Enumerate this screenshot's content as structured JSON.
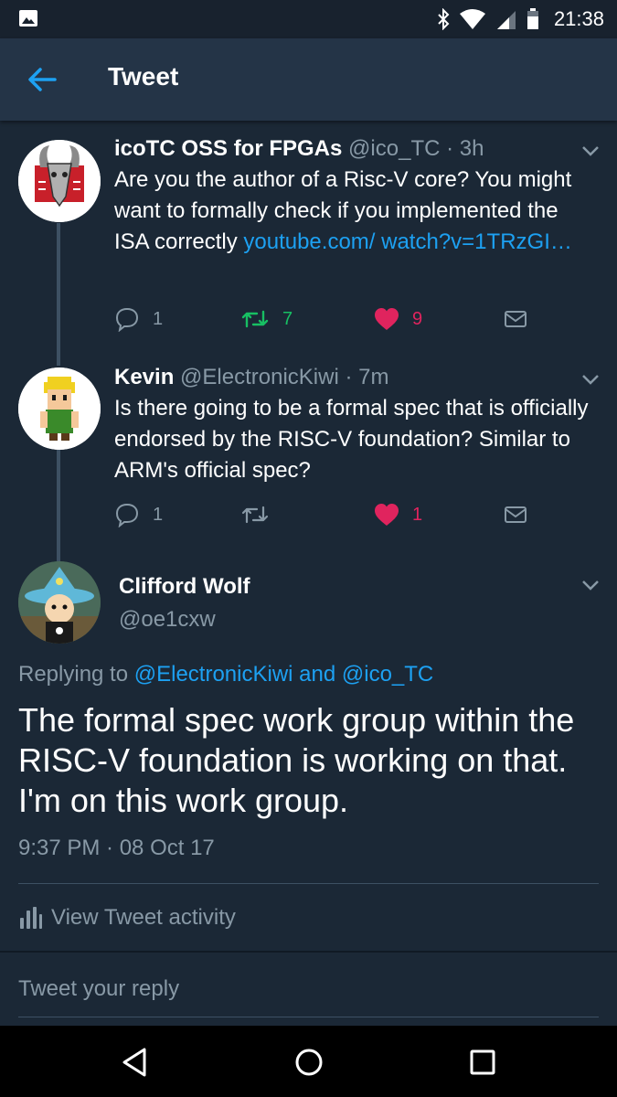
{
  "status_bar": {
    "time": "21:38"
  },
  "header": {
    "title": "Tweet"
  },
  "thread": [
    {
      "name": "icoTC OSS for FPGAs",
      "handle": "@ico_TC",
      "time": "· 3h",
      "text": "Are you the author of a Risc-V core? You might want to formally check if you implemented the ISA correctly ",
      "link": "youtube.com/ watch?v=1TRzGI…",
      "replies": "1",
      "retweets": "7",
      "likes": "9",
      "retweeted": true,
      "liked": true
    },
    {
      "name": "Kevin",
      "handle": "@ElectronicKiwi",
      "time": "· 7m",
      "text": "Is there going to be a formal spec that is officially endorsed by the RISC-V foundation? Similar to ARM's official spec?",
      "replies": "1",
      "retweets": "",
      "likes": "1",
      "retweeted": false,
      "liked": true
    }
  ],
  "main_tweet": {
    "name": "Clifford Wolf",
    "handle": "@oe1cxw",
    "replying_prefix": "Replying to ",
    "replying_users": "@ElectronicKiwi and @ico_TC",
    "text": "The formal spec work group within the RISC-V foundation is working on that. I'm on this work group.",
    "timestamp": "9:37 PM · 08 Oct 17",
    "activity_label": "View Tweet activity"
  },
  "reply": {
    "placeholder": "Tweet your reply"
  },
  "colors": {
    "background": "#1b2836",
    "appbar": "#243447",
    "accent": "#1da1f2",
    "retweet_green": "#17bf63",
    "like_pink": "#e0245e",
    "muted": "#8899a6"
  }
}
